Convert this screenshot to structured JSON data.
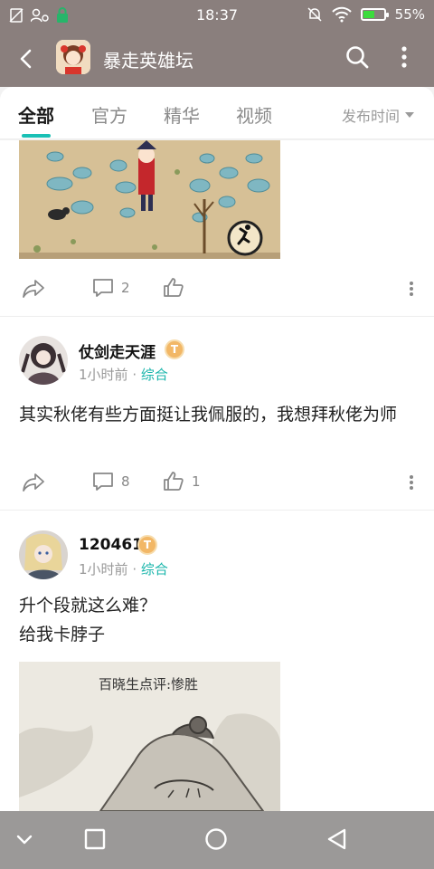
{
  "status": {
    "time": "18:37",
    "battery": "55%",
    "battery_level": 0.55
  },
  "appbar": {
    "title": "暴走英雄坛"
  },
  "tabs": {
    "items": [
      "全部",
      "官方",
      "精华",
      "视频"
    ],
    "active": 0,
    "sort_label": "发布时间"
  },
  "posts": [
    {
      "shares": "",
      "comments": "2",
      "likes": ""
    },
    {
      "username": "仗剑走天涯",
      "badge": "T",
      "time": "1小时前",
      "separator": "·",
      "category": "综合",
      "text": "其实秋佬有些方面挺让我佩服的，我想拜秋佬为师",
      "comments": "8",
      "likes": "1"
    },
    {
      "username": "120461",
      "badge": "T",
      "time": "1小时前",
      "separator": "·",
      "category": "综合",
      "text_line1": "升个段就这么难？",
      "text_line2": "给我卡脖子",
      "image_caption": "百晓生点评:惨胜"
    }
  ]
}
